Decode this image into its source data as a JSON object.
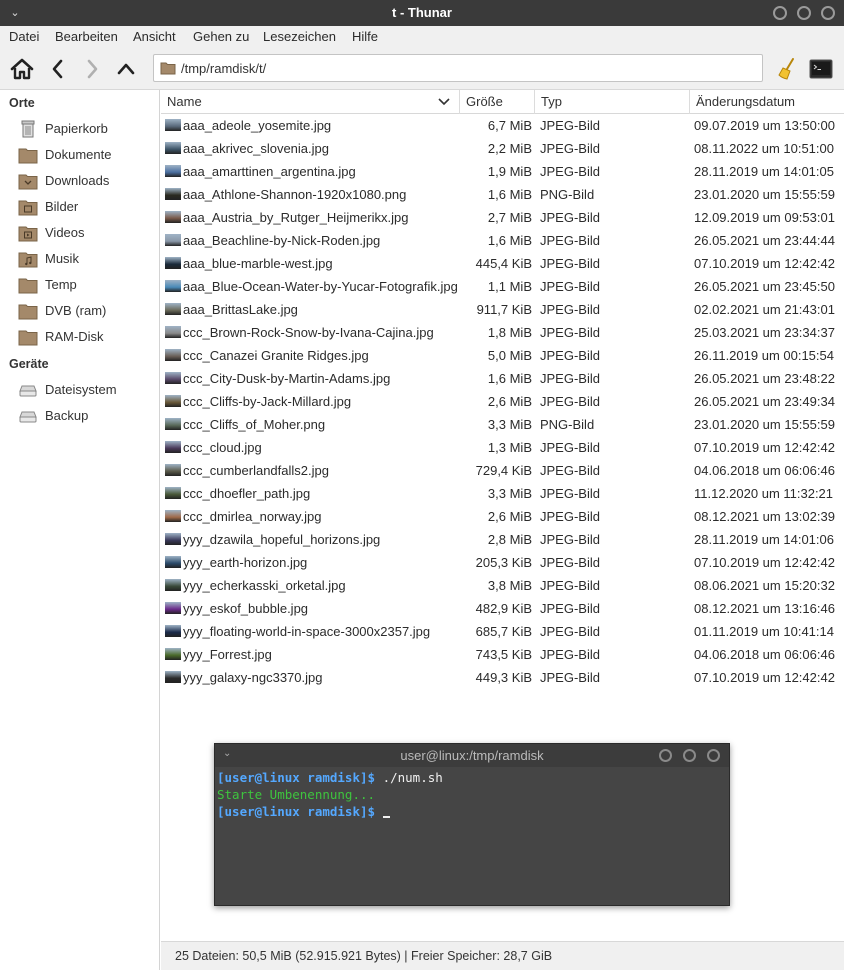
{
  "window": {
    "title": "t - Thunar"
  },
  "menubar": [
    "Datei",
    "Bearbeiten",
    "Ansicht",
    "Gehen zu",
    "Lesezeichen",
    "Hilfe"
  ],
  "location": {
    "path": "/tmp/ramdisk/t/"
  },
  "sidebar": {
    "places_heading": "Orte",
    "places": [
      {
        "label": "Papierkorb",
        "icon": "trash-icon"
      },
      {
        "label": "Dokumente",
        "icon": "folder-icon"
      },
      {
        "label": "Downloads",
        "icon": "folder-download-icon"
      },
      {
        "label": "Bilder",
        "icon": "folder-pictures-icon"
      },
      {
        "label": "Videos",
        "icon": "folder-videos-icon"
      },
      {
        "label": "Musik",
        "icon": "folder-music-icon"
      },
      {
        "label": "Temp",
        "icon": "folder-icon"
      },
      {
        "label": "DVB (ram)",
        "icon": "folder-icon"
      },
      {
        "label": "RAM-Disk",
        "icon": "folder-icon"
      }
    ],
    "devices_heading": "Geräte",
    "devices": [
      {
        "label": "Dateisystem",
        "icon": "drive-icon"
      },
      {
        "label": "Backup",
        "icon": "drive-icon"
      }
    ]
  },
  "columns": {
    "name": "Name",
    "size": "Größe",
    "type": "Typ",
    "date": "Änderungsdatum"
  },
  "files": [
    {
      "name": "aaa_adeole_yosemite.jpg",
      "size": "6,7 MiB",
      "type": "JPEG-Bild",
      "date": "09.07.2019 um 13:50:00",
      "thumb": "#5a6a7c"
    },
    {
      "name": "aaa_akrivec_slovenia.jpg",
      "size": "2,2 MiB",
      "type": "JPEG-Bild",
      "date": "08.11.2022 um 10:51:00",
      "thumb": "#3e5568"
    },
    {
      "name": "aaa_amarttinen_argentina.jpg",
      "size": "1,9 MiB",
      "type": "JPEG-Bild",
      "date": "28.11.2019 um 14:01:05",
      "thumb": "#4a6fa0"
    },
    {
      "name": "aaa_Athlone-Shannon-1920x1080.png",
      "size": "1,6 MiB",
      "type": "PNG-Bild",
      "date": "23.01.2020 um 15:55:59",
      "thumb": "#2a2a20"
    },
    {
      "name": "aaa_Austria_by_Rutger_Heijmerikx.jpg",
      "size": "2,7 MiB",
      "type": "JPEG-Bild",
      "date": "12.09.2019 um 09:53:01",
      "thumb": "#7a5a4a"
    },
    {
      "name": "aaa_Beachline-by-Nick-Roden.jpg",
      "size": "1,6 MiB",
      "type": "JPEG-Bild",
      "date": "26.05.2021 um 23:44:44",
      "thumb": "#8a98a8"
    },
    {
      "name": "aaa_blue-marble-west.jpg",
      "size": "445,4 KiB",
      "type": "JPEG-Bild",
      "date": "07.10.2019 um 12:42:42",
      "thumb": "#1a2a3a"
    },
    {
      "name": "aaa_Blue-Ocean-Water-by-Yucar-Fotografik.jpg",
      "size": "1,1 MiB",
      "type": "JPEG-Bild",
      "date": "26.05.2021 um 23:45:50",
      "thumb": "#4a8ab8"
    },
    {
      "name": "aaa_BrittasLake.jpg",
      "size": "911,7 KiB",
      "type": "JPEG-Bild",
      "date": "02.02.2021 um 21:43:01",
      "thumb": "#6a6a5a"
    },
    {
      "name": "ccc_Brown-Rock-Snow-by-Ivana-Cajina.jpg",
      "size": "1,8 MiB",
      "type": "JPEG-Bild",
      "date": "25.03.2021 um 23:34:37",
      "thumb": "#8a8a8a"
    },
    {
      "name": "ccc_Canazei Granite Ridges.jpg",
      "size": "5,0 MiB",
      "type": "JPEG-Bild",
      "date": "26.11.2019 um 00:15:54",
      "thumb": "#6a6058"
    },
    {
      "name": "ccc_City-Dusk-by-Martin-Adams.jpg",
      "size": "1,6 MiB",
      "type": "JPEG-Bild",
      "date": "26.05.2021 um 23:48:22",
      "thumb": "#5a4a6a"
    },
    {
      "name": "ccc_Cliffs-by-Jack-Millard.jpg",
      "size": "2,6 MiB",
      "type": "JPEG-Bild",
      "date": "26.05.2021 um 23:49:34",
      "thumb": "#6a5a3a"
    },
    {
      "name": "ccc_Cliffs_of_Moher.png",
      "size": "3,3 MiB",
      "type": "PNG-Bild",
      "date": "23.01.2020 um 15:55:59",
      "thumb": "#5a6a5a"
    },
    {
      "name": "ccc_cloud.jpg",
      "size": "1,3 MiB",
      "type": "JPEG-Bild",
      "date": "07.10.2019 um 12:42:42",
      "thumb": "#4a3a5a"
    },
    {
      "name": "ccc_cumberlandfalls2.jpg",
      "size": "729,4 KiB",
      "type": "JPEG-Bild",
      "date": "04.06.2018 um 06:06:46",
      "thumb": "#5a5a4a"
    },
    {
      "name": "ccc_dhoefler_path.jpg",
      "size": "3,3 MiB",
      "type": "JPEG-Bild",
      "date": "11.12.2020 um 11:32:21",
      "thumb": "#4a5a3a"
    },
    {
      "name": "ccc_dmirlea_norway.jpg",
      "size": "2,6 MiB",
      "type": "JPEG-Bild",
      "date": "08.12.2021 um 13:02:39",
      "thumb": "#a06a4a"
    },
    {
      "name": "yyy_dzawila_hopeful_horizons.jpg",
      "size": "2,8 MiB",
      "type": "JPEG-Bild",
      "date": "28.11.2019 um 14:01:06",
      "thumb": "#3a3a5a"
    },
    {
      "name": "yyy_earth-horizon.jpg",
      "size": "205,3 KiB",
      "type": "JPEG-Bild",
      "date": "07.10.2019 um 12:42:42",
      "thumb": "#2a4a6a"
    },
    {
      "name": "yyy_echerkasski_orketal.jpg",
      "size": "3,8 MiB",
      "type": "JPEG-Bild",
      "date": "08.06.2021 um 15:20:32",
      "thumb": "#3a4a3a"
    },
    {
      "name": "yyy_eskof_bubble.jpg",
      "size": "482,9 KiB",
      "type": "JPEG-Bild",
      "date": "08.12.2021 um 13:16:46",
      "thumb": "#6a2a8a"
    },
    {
      "name": "yyy_floating-world-in-space-3000x2357.jpg",
      "size": "685,7 KiB",
      "type": "JPEG-Bild",
      "date": "01.11.2019 um 10:41:14",
      "thumb": "#1a2a4a"
    },
    {
      "name": "yyy_Forrest.jpg",
      "size": "743,5 KiB",
      "type": "JPEG-Bild",
      "date": "04.06.2018 um 06:06:46",
      "thumb": "#4a6a2a"
    },
    {
      "name": "yyy_galaxy-ngc3370.jpg",
      "size": "449,3 KiB",
      "type": "JPEG-Bild",
      "date": "07.10.2019 um 12:42:42",
      "thumb": "#2a2a2a"
    }
  ],
  "statusbar": {
    "text": "25 Dateien: 50,5 MiB (52.915.921 Bytes)  |  Freier Speicher: 28,7 GiB"
  },
  "terminal": {
    "title": "user@linux:/tmp/ramdisk",
    "prompt": "[user@linux ramdisk]$",
    "command": " ./num.sh",
    "output": "Starte Umbenennung...",
    "prompt2": "[user@linux ramdisk]$",
    "colors": {
      "prompt": "#54a8ff",
      "output": "#3ec43e"
    }
  }
}
